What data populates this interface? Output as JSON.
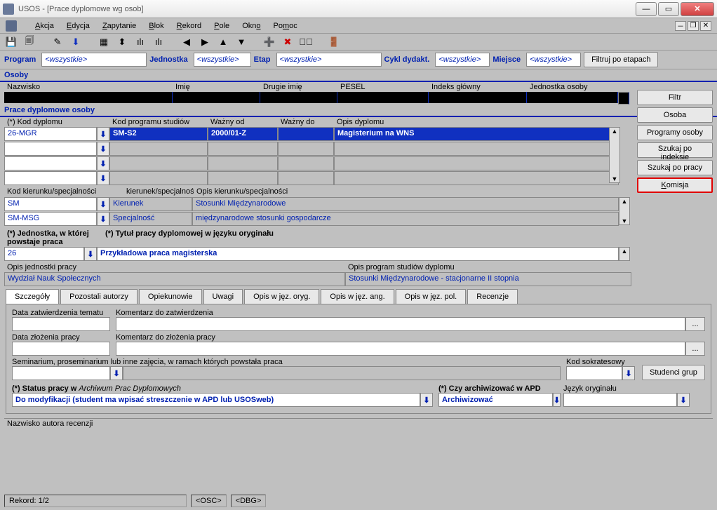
{
  "window": {
    "title": "USOS - [Prace dyplomowe wg osob]"
  },
  "menu": [
    "Akcja",
    "Edycja",
    "Zapytanie",
    "Blok",
    "Rekord",
    "Pole",
    "Okno",
    "Pomoc"
  ],
  "filter": {
    "program_lbl": "Program",
    "program_val": "<wszystkie>",
    "jednostka_lbl": "Jednostka",
    "jednostka_val": "<wszystkie>",
    "etap_lbl": "Etap",
    "etap_val": "<wszystkie>",
    "cykl_lbl": "Cykl dydakt.",
    "cykl_val": "<wszystkie>",
    "miejsce_lbl": "Miejsce",
    "miejsce_val": "<wszystkie>",
    "btn": "Filtruj po etapach"
  },
  "osoby_title": "Osoby",
  "osoby_cols": [
    "Nazwisko",
    "Imię",
    "Drugie imię",
    "PESEL",
    "Indeks główny",
    "Jednostka osoby"
  ],
  "right_buttons": [
    "Filtr",
    "Osoba",
    "Programy osoby",
    "Szukaj po indeksie",
    "Szukaj po pracy",
    "Komisja"
  ],
  "prace_title": "Prace dyplomowe osoby",
  "dip_cols": [
    "(*) Kod dyplomu",
    "Kod programu studiów",
    "Ważny od",
    "Ważny do",
    "Opis dyplomu"
  ],
  "dip_rows": [
    {
      "kod": "26-MGR",
      "prog": "SM-S2",
      "wo": "2000/01-Z",
      "wd": "",
      "opis": "Magisterium na WNS"
    }
  ],
  "spec_hdrs": [
    "Kod kierunku/specjalności",
    "kierunek/specjalność",
    "Opis kierunku/specjalności"
  ],
  "specs": [
    {
      "kod": "SM",
      "typ": "Kierunek",
      "opis": "Stosunki Międzynarodowe"
    },
    {
      "kod": "SM-MSG",
      "typ": "Specjalność",
      "opis": "międzynarodowe stosunki gospodarcze"
    }
  ],
  "jedn_lbl": "(*) Jednostka, w której powstaje praca",
  "jedn_val": "26",
  "tytul_lbl": "(*) Tytuł pracy dyplomowej w języku oryginału",
  "tytul_val": "Przykładowa praca magisterska",
  "opis_jedn_lbl": "Opis jednostki pracy",
  "opis_jedn_val": "Wydział Nauk Społecznych",
  "opis_prog_lbl": "Opis program studiów dyplomu",
  "opis_prog_val": "Stosunki Międzynarodowe - stacjonarne II stopnia",
  "tabs": [
    "Szczegóły",
    "Pozostali autorzy",
    "Opiekunowie",
    "Uwagi",
    "Opis w jęz. oryg.",
    "Opis w jęz. ang.",
    "Opis w jęz. pol.",
    "Recenzje"
  ],
  "details": {
    "data_zatw": "Data zatwierdzenia tematu",
    "kom_zatw": "Komentarz do zatwierdzenia",
    "data_zloz": "Data złożenia pracy",
    "kom_zloz": "Komentarz do złożenia pracy",
    "seminarium": "Seminarium, proseminarium lub inne zajęcia, w ramach których powstała praca",
    "kod_sokr": "Kod sokratesowy",
    "studenci_grup": "Studenci grup",
    "status_lbl": "(*) Status pracy w",
    "status_suf": "Archiwum Prac Dyplomowych",
    "status_val": "Do modyfikacji (student ma wpisać streszczenie w APD lub USOSweb)",
    "archiw_lbl": "(*) Czy archiwizować w APD",
    "archiw_val": "Archiwizować",
    "jez_lbl": "Język oryginału"
  },
  "footer": {
    "recenzja": "Nazwisko autora recenzji",
    "rekord": "Rekord: 1/2",
    "osc": "<OSC>",
    "dbg": "<DBG>"
  }
}
